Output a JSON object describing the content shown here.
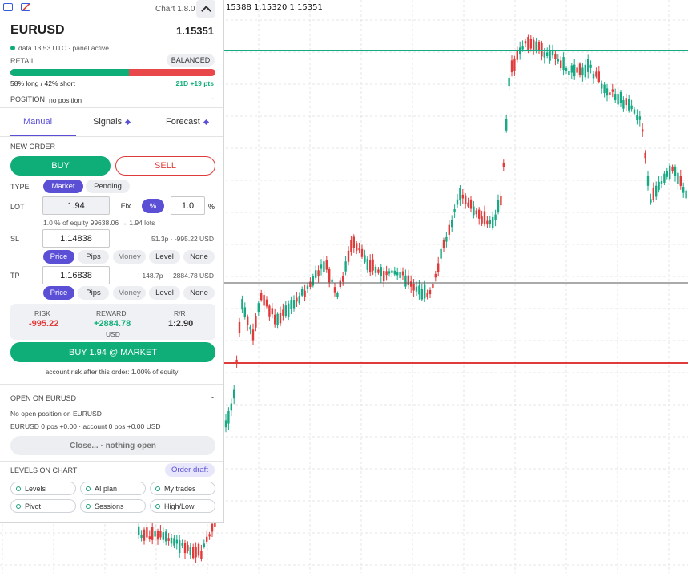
{
  "header": {
    "version": "Chart 1.8.0"
  },
  "symbol": {
    "name": "EURUSD",
    "price": "1.15351",
    "status": "data 13:53 UTC · panel active"
  },
  "retail": {
    "label": "RETAIL",
    "badge": "BALANCED",
    "long_pct": 58,
    "split_text": "58% long / 42% short",
    "trend": "21D +19 pts"
  },
  "position": {
    "label": "POSITION",
    "value": "no position",
    "dash": "-"
  },
  "tabs": [
    {
      "label": "Manual"
    },
    {
      "label": "Signals"
    },
    {
      "label": "Forecast"
    }
  ],
  "order": {
    "title": "NEW ORDER",
    "buy": "BUY",
    "sell": "SELL",
    "type_label": "TYPE",
    "type_options": [
      "Market",
      "Pending"
    ],
    "lot_label": "LOT",
    "lot_value": "1.94",
    "fix": "Fix",
    "pct_btn": "%",
    "pct_value": "1.0",
    "pct_unit": "%",
    "equity_note": "1.0 % of equity 99638.06 → 1.94 lots",
    "sl_label": "SL",
    "sl_value": "1.14838",
    "sl_info": "51.3p · -995.22 USD",
    "tp_label": "TP",
    "tp_value": "1.16838",
    "tp_info": "148.7p · +2884.78 USD",
    "mode_options": [
      "Price",
      "Pips",
      "Money",
      "Level",
      "None"
    ],
    "risk_label": "RISK",
    "risk_value": "-995.22",
    "reward_label": "REWARD",
    "reward_value": "+2884.78",
    "reward_unit": "USD",
    "rr_label": "R/R",
    "rr_value": "1:2.90",
    "submit": "BUY 1.94 @ MARKET",
    "risk_note": "account risk after this order: 1.00% of equity"
  },
  "open": {
    "title": "OPEN ON EURUSD",
    "dash": "-",
    "line1": "No open position on EURUSD",
    "line2": "EURUSD 0 pos +0.00 · account 0 pos +0.00 USD",
    "close_btn": "Close... · nothing open"
  },
  "levels": {
    "title": "LEVELS ON CHART",
    "draft": "Order draft",
    "chips": [
      "Levels",
      "AI plan",
      "My trades",
      "Pivot",
      "Sessions",
      "High/Low"
    ]
  },
  "chart_overlay": {
    "ohlc": "15388 1.15320 1.15351"
  },
  "colors": {
    "accent": "#5b4fd6",
    "buy": "#0fae78",
    "sell": "#e03b3b"
  }
}
